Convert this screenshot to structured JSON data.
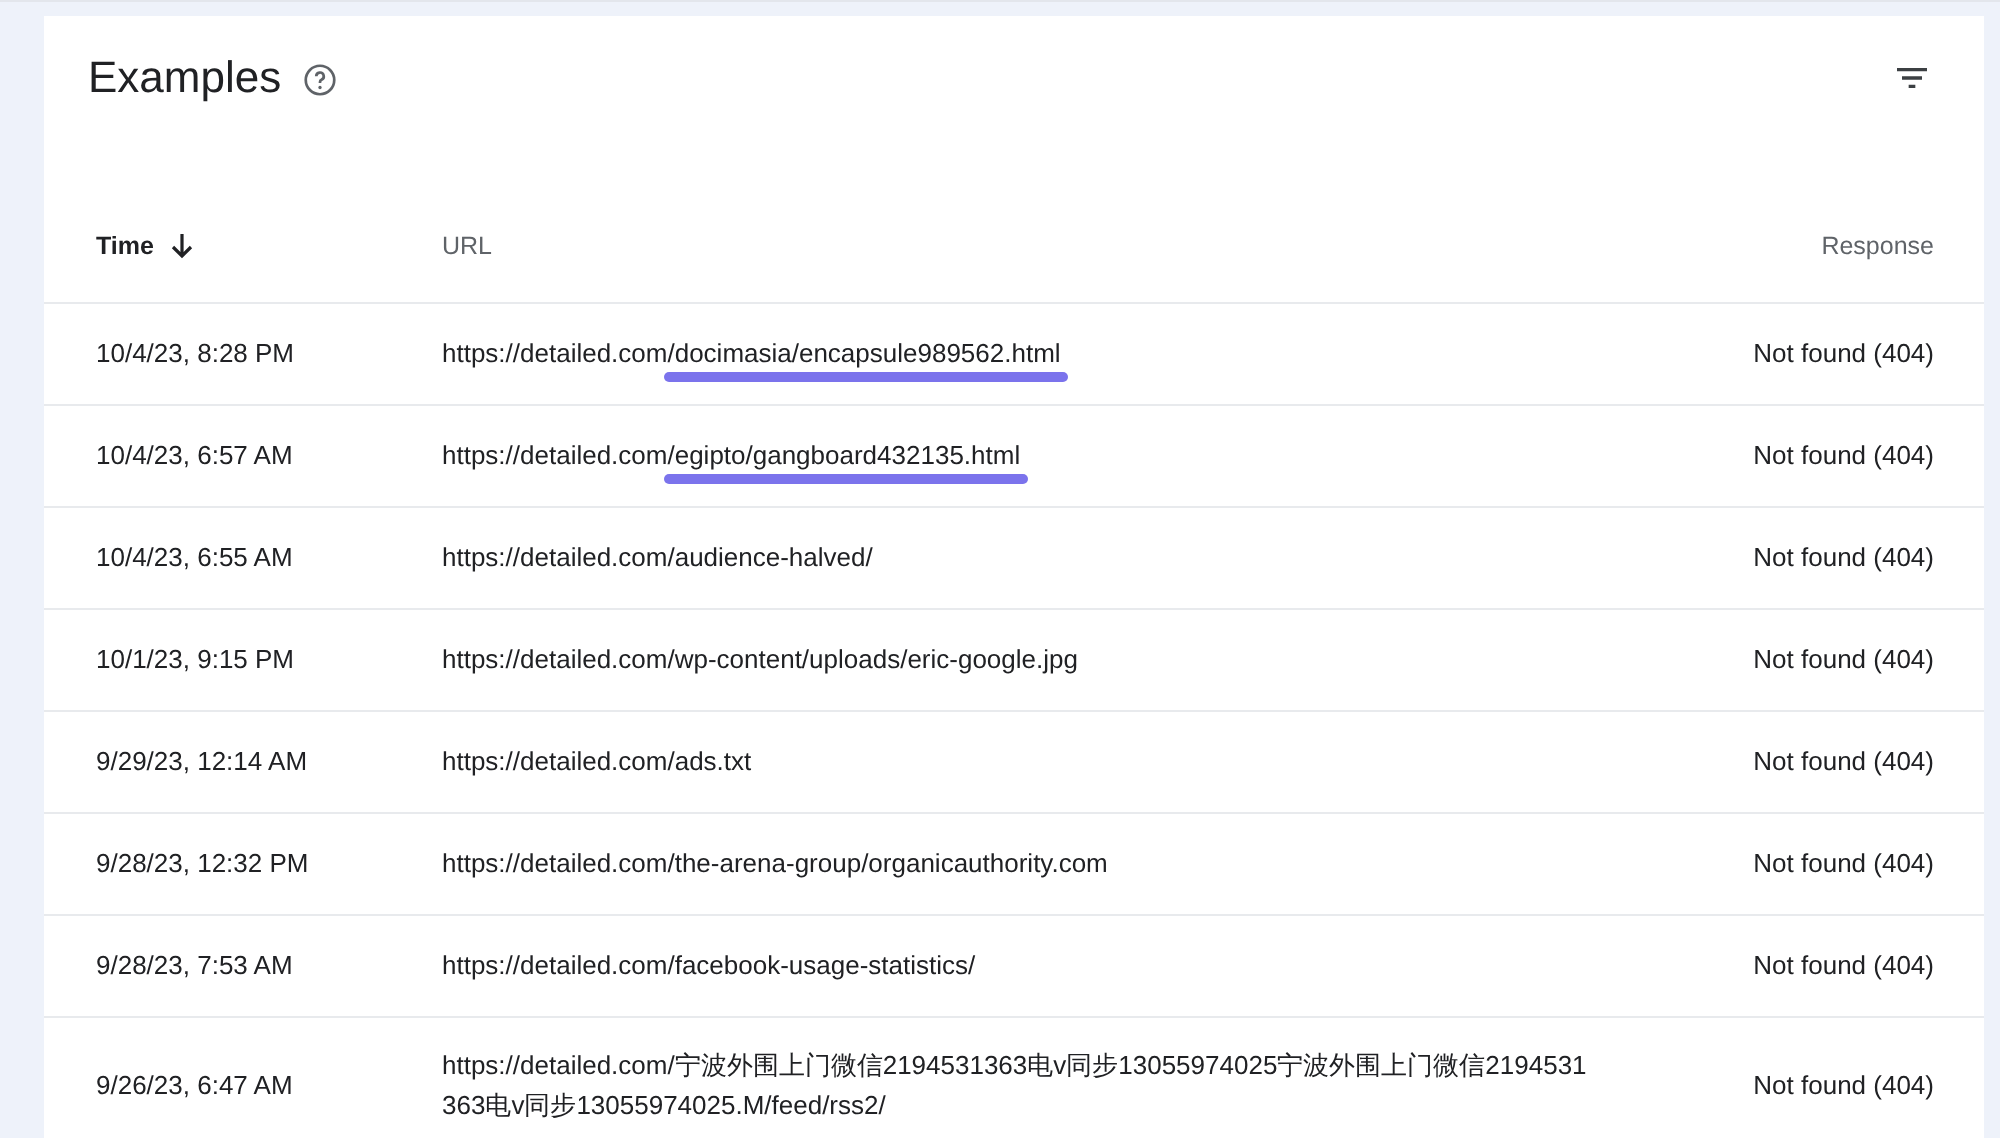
{
  "card": {
    "title": "Examples"
  },
  "table": {
    "columns": [
      {
        "label": "Time",
        "sorted_descending": true
      },
      {
        "label": "URL"
      },
      {
        "label": "Response"
      }
    ],
    "rows": [
      {
        "time": "10/4/23, 8:28 PM",
        "url": "https://detailed.com/docimasia/encapsule989562.html",
        "response": "Not found (404)",
        "underlined": true
      },
      {
        "time": "10/4/23, 6:57 AM",
        "url": "https://detailed.com/egipto/gangboard432135.html",
        "response": "Not found (404)",
        "underlined": true
      },
      {
        "time": "10/4/23, 6:55 AM",
        "url": "https://detailed.com/audience-halved/",
        "response": "Not found (404)",
        "underlined": false
      },
      {
        "time": "10/1/23, 9:15 PM",
        "url": "https://detailed.com/wp-content/uploads/eric-google.jpg",
        "response": "Not found (404)",
        "underlined": false
      },
      {
        "time": "9/29/23, 12:14 AM",
        "url": "https://detailed.com/ads.txt",
        "response": "Not found (404)",
        "underlined": false
      },
      {
        "time": "9/28/23, 12:32 PM",
        "url": "https://detailed.com/the-arena-group/organicauthority.com",
        "response": "Not found (404)",
        "underlined": false
      },
      {
        "time": "9/28/23, 7:53 AM",
        "url": "https://detailed.com/facebook-usage-statistics/",
        "response": "Not found (404)",
        "underlined": false
      },
      {
        "time": "9/26/23, 6:47 AM",
        "url": "https://detailed.com/宁波外围上门微信2194531363电v同步13055974025宁波外围上门微信2194531363电v同步13055974025.M/feed/rss2/",
        "response": "Not found (404)",
        "underlined": false
      }
    ]
  }
}
